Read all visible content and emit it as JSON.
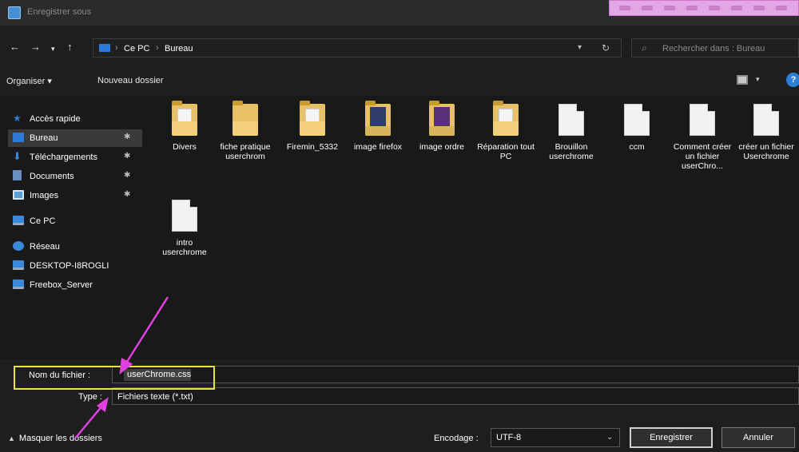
{
  "window": {
    "title": "Enregistrer sous"
  },
  "address": {
    "crumbs": [
      "Ce PC",
      "Bureau"
    ],
    "search_placeholder": "Rechercher dans : Bureau"
  },
  "toolbar": {
    "organize_label": "Organiser ▾",
    "new_folder_label": "Nouveau dossier"
  },
  "sidebar": {
    "items": [
      {
        "label": "Accès rapide",
        "icon": "star-icon",
        "color": "#2b7fd8",
        "pinned": false
      },
      {
        "label": "Bureau",
        "icon": "desktop-folder-icon",
        "color": "#2d7bd6",
        "pinned": true
      },
      {
        "label": "Téléchargements",
        "icon": "download-icon",
        "color": "#3a88dc",
        "pinned": true
      },
      {
        "label": "Documents",
        "icon": "documents-icon",
        "color": "#6b8fc0",
        "pinned": true
      },
      {
        "label": "Images",
        "icon": "images-icon",
        "color": "#5aa0d8",
        "pinned": true
      },
      {
        "label": "Ce PC",
        "icon": "computer-icon",
        "color": "#3a88dc",
        "pinned": false
      },
      {
        "label": "Réseau",
        "icon": "network-icon",
        "color": "#3a88dc",
        "pinned": false
      },
      {
        "label": "DESKTOP-I8ROGLI",
        "icon": "computer-icon",
        "color": "#3a88dc",
        "pinned": false
      },
      {
        "label": "Freebox_Server",
        "icon": "computer-icon",
        "color": "#3a88dc",
        "pinned": false
      }
    ]
  },
  "files": [
    {
      "name": "Divers",
      "kind": "folder",
      "icon": "folder-icon"
    },
    {
      "name": "fiche pratique userchrom",
      "kind": "folder",
      "icon": "folder-icon"
    },
    {
      "name": "Firemin_5332",
      "kind": "folder",
      "icon": "folder-icon"
    },
    {
      "name": "image firefox",
      "kind": "folder",
      "icon": "folder-image-icon"
    },
    {
      "name": "image ordre",
      "kind": "folder",
      "icon": "folder-image-icon"
    },
    {
      "name": "Réparation tout PC",
      "kind": "folder",
      "icon": "folder-icon"
    },
    {
      "name": "Brouillon userchrome",
      "kind": "document",
      "icon": "text-file-icon"
    },
    {
      "name": "ccm",
      "kind": "document",
      "icon": "text-file-icon"
    },
    {
      "name": "Comment créer un fichier userChro...",
      "kind": "document",
      "icon": "text-file-icon"
    },
    {
      "name": "créer un fichier Userchrome",
      "kind": "document",
      "icon": "text-file-icon"
    },
    {
      "name": "intro userchrome",
      "kind": "document",
      "icon": "text-file-icon"
    }
  ],
  "form": {
    "filename_label": "Nom du fichier :",
    "filename_value": "userChrome.css",
    "type_label": "Type :",
    "type_value": "Fichiers texte (*.txt)",
    "toggle_label": "Masquer les dossiers",
    "encoding_label": "Encodage :",
    "encoding_value": "UTF-8",
    "save_label": "Enregistrer",
    "cancel_label": "Annuler"
  },
  "annotations": {
    "highlight_color": "#e9e43a",
    "arrow_color": "#e040e0"
  }
}
